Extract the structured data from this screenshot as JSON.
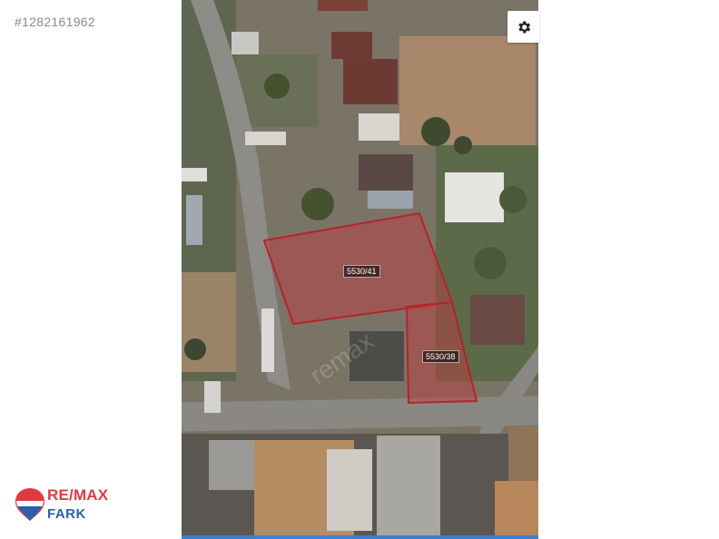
{
  "listing": {
    "id_text": "#1282161962"
  },
  "map": {
    "type": "satellite",
    "parcels": [
      {
        "label": "5530/41",
        "fill": "#c4383e"
      },
      {
        "label": "5530/38",
        "fill": "#c4383e"
      }
    ],
    "settings_icon": "gear-icon",
    "watermark": "remax"
  },
  "branding": {
    "logo_top": "RE/MAX",
    "logo_bottom": "FARK",
    "colors": {
      "red": "#e0393e",
      "blue": "#2a62a8"
    }
  }
}
